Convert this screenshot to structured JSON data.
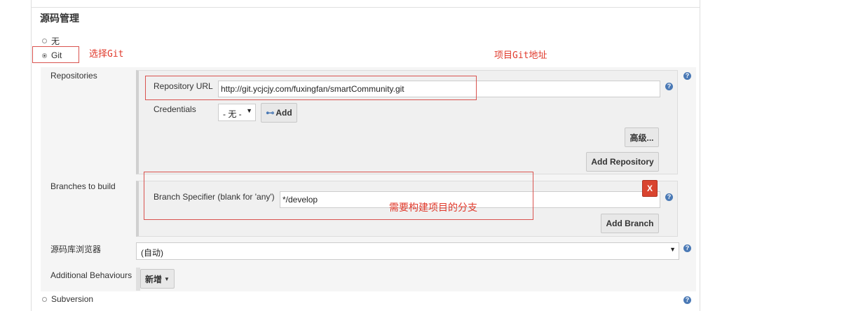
{
  "section": {
    "title": "源码管理"
  },
  "scm_options": {
    "none": "无",
    "git": "Git",
    "subversion": "Subversion"
  },
  "annotations": {
    "select_git": "选择Git",
    "git_url": "项目Git地址",
    "branch": "需要构建项目的分支"
  },
  "repositories": {
    "label": "Repositories",
    "url_label": "Repository URL",
    "url_value": "http://git.ycjcjy.com/fuxingfan/smartCommunity.git",
    "credentials_label": "Credentials",
    "credentials_value": "- 无 -",
    "add_button": "Add",
    "advanced_button": "高级...",
    "add_repository_button": "Add Repository"
  },
  "branches": {
    "label": "Branches to build",
    "specifier_label": "Branch Specifier (blank for 'any')",
    "specifier_value": "*/develop",
    "delete_button": "X",
    "add_branch_button": "Add Branch"
  },
  "browser": {
    "label": "源码库浏览器",
    "value": "(自动)"
  },
  "behaviours": {
    "label": "Additional Behaviours",
    "add_button": "新增"
  },
  "colors": {
    "annotation": "#e0392b",
    "help": "#4a79b5",
    "delete": "#d9442f"
  }
}
